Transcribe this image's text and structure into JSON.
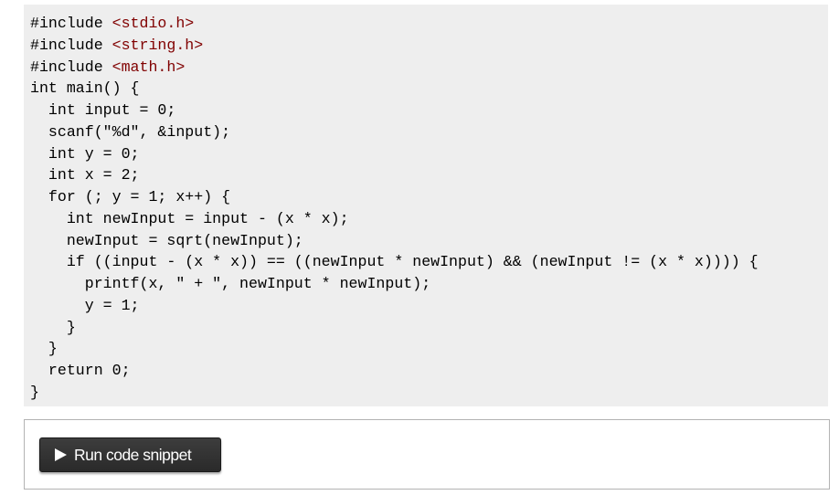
{
  "code_block": {
    "language": "c",
    "lines": [
      {
        "parts": [
          {
            "text": "#include ",
            "kind": "plain"
          },
          {
            "text": "<stdio.h>",
            "kind": "string"
          }
        ]
      },
      {
        "parts": [
          {
            "text": "#include ",
            "kind": "plain"
          },
          {
            "text": "<string.h>",
            "kind": "string"
          }
        ]
      },
      {
        "parts": [
          {
            "text": "#include ",
            "kind": "plain"
          },
          {
            "text": "<math.h>",
            "kind": "string"
          }
        ]
      },
      {
        "parts": [
          {
            "text": "int main() {",
            "kind": "plain"
          }
        ]
      },
      {
        "parts": [
          {
            "text": "  int input = 0;",
            "kind": "plain"
          }
        ]
      },
      {
        "parts": [
          {
            "text": "  scanf(\"%d\", &input);",
            "kind": "plain"
          }
        ]
      },
      {
        "parts": [
          {
            "text": "  int y = 0;",
            "kind": "plain"
          }
        ]
      },
      {
        "parts": [
          {
            "text": "  int x = 2;",
            "kind": "plain"
          }
        ]
      },
      {
        "parts": [
          {
            "text": "  for (; y = 1; x++) {",
            "kind": "plain"
          }
        ]
      },
      {
        "parts": [
          {
            "text": "    int newInput = input - (x * x);",
            "kind": "plain"
          }
        ]
      },
      {
        "parts": [
          {
            "text": "    newInput = sqrt(newInput);",
            "kind": "plain"
          }
        ]
      },
      {
        "parts": [
          {
            "text": "    if ((input - (x * x)) == ((newInput * newInput) && (newInput != (x * x)))) {",
            "kind": "plain"
          }
        ]
      },
      {
        "parts": [
          {
            "text": "      printf(x, \" + \", newInput * newInput);",
            "kind": "plain"
          }
        ]
      },
      {
        "parts": [
          {
            "text": "      y = 1;",
            "kind": "plain"
          }
        ]
      },
      {
        "parts": [
          {
            "text": "    }",
            "kind": "plain"
          }
        ]
      },
      {
        "parts": [
          {
            "text": "  }",
            "kind": "plain"
          }
        ]
      },
      {
        "parts": [
          {
            "text": "  return 0;",
            "kind": "plain"
          }
        ]
      },
      {
        "parts": [
          {
            "text": "}",
            "kind": "plain"
          }
        ]
      }
    ]
  },
  "snippet_toolbar": {
    "run_button": {
      "icon": "play-icon",
      "label": "Run code snippet"
    }
  },
  "colors": {
    "code_background": "#eeeeee",
    "string_color": "#800000",
    "button_background": "#333333",
    "button_text": "#ffffff"
  }
}
